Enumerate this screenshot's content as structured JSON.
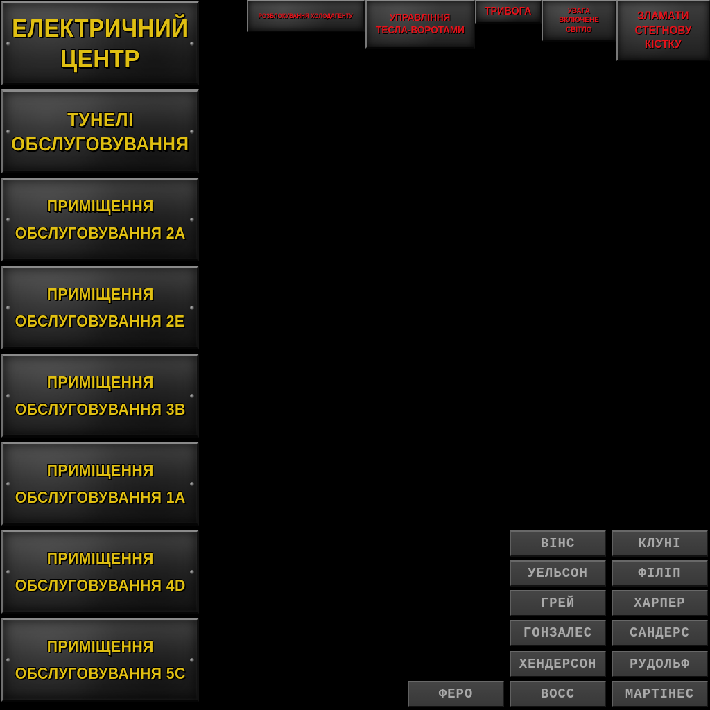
{
  "locations": [
    {
      "line1": "ЕЛЕКТРИЧНИЙ",
      "line2": "ЦЕНТР"
    },
    {
      "line1": "ТУНЕЛІ",
      "line2": "ОБСЛУГОВУВАННЯ"
    },
    {
      "line1": "ПРИМІЩЕННЯ",
      "line2": "ОБСЛУГОВУВАННЯ 2А"
    },
    {
      "line1": "ПРИМІЩЕННЯ",
      "line2": "ОБСЛУГОВУВАННЯ 2Е"
    },
    {
      "line1": "ПРИМІЩЕННЯ",
      "line2": "ОБСЛУГОВУВАННЯ 3В"
    },
    {
      "line1": "ПРИМІЩЕННЯ",
      "line2": "ОБСЛУГОВУВАННЯ 1А"
    },
    {
      "line1": "ПРИМІЩЕННЯ",
      "line2": "ОБСЛУГОВУВАННЯ 4D"
    },
    {
      "line1": "ПРИМІЩЕННЯ",
      "line2": "ОБСЛУГОВУВАННЯ 5С"
    }
  ],
  "actions": {
    "coolant": {
      "line1": "РОЗБЛОКУВАННЯ ХОЛОДАГЕНТУ"
    },
    "tesla": {
      "line1": "УПРАВЛІННЯ",
      "line2": "ТЕСЛА-ВОРОТАМИ"
    },
    "alarm": {
      "line1": "ТРИВОГА"
    },
    "lights": {
      "line1": "УВАГА",
      "line2": "ВКЛЮЧЕНЕ",
      "line3": "СВІТЛО"
    },
    "femur": {
      "line1": "ЗЛАМАТИ",
      "line2": "СТЕГНОВУ",
      "line3": "КІСТКУ"
    }
  },
  "personnel": {
    "vince": "ВІНС",
    "clooney": "КЛУНІ",
    "welson": "УЕЛЬСОН",
    "philip": "ФІЛІП",
    "grey": "ГРЕЙ",
    "harper": "ХАРПЕР",
    "gonzales": "ГОНЗАЛЕС",
    "sanders": "САНДЕРС",
    "henderson": "ХЕНДЕРСОН",
    "rudolph": "РУДОЛЬФ",
    "fero": "ФЕРО",
    "voss": "ВОСС",
    "martinez": "МАРТІНЕС"
  },
  "colors": {
    "location_text": "#e0bf12",
    "action_text": "#e4131b",
    "name_text": "#a9a9a9",
    "background": "#000000"
  }
}
